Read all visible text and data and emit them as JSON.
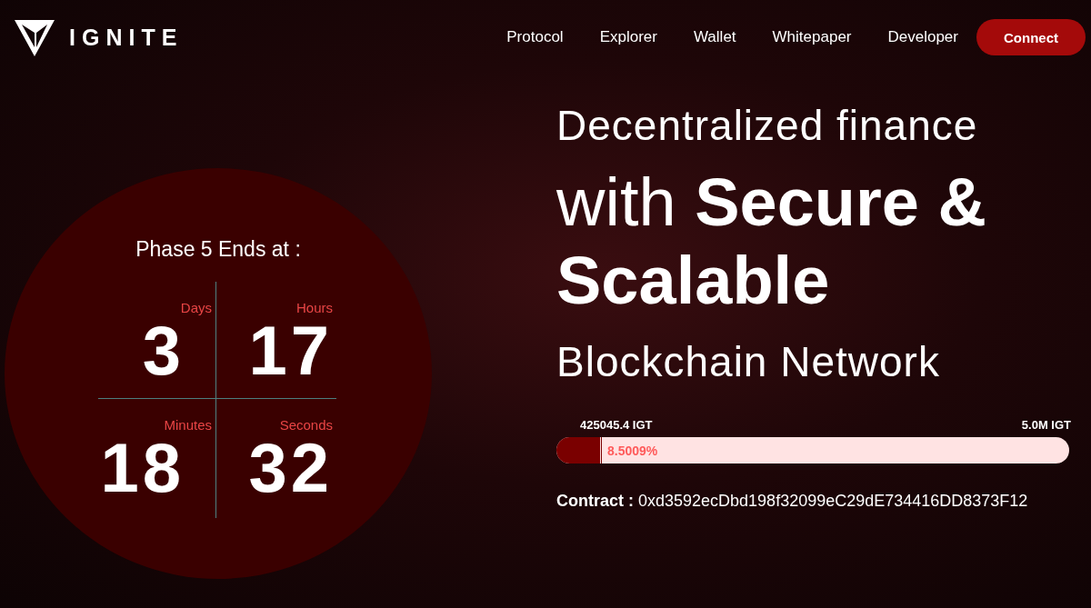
{
  "brand": {
    "name": "IGNITE"
  },
  "nav": {
    "items": [
      "Protocol",
      "Explorer",
      "Wallet",
      "Whitepaper",
      "Developer"
    ],
    "button": "Connect"
  },
  "countdown": {
    "title": "Phase 5 Ends at :",
    "units": [
      {
        "label": "Days",
        "value": "3"
      },
      {
        "label": "Hours",
        "value": "17"
      },
      {
        "label": "Minutes",
        "value": "18"
      },
      {
        "label": "Seconds",
        "value": "32"
      }
    ]
  },
  "hero": {
    "line_1": "Decentralized finance",
    "line_2": "with **Secure & Scalable**",
    "line_3": "Blockchain Network"
  },
  "progress": {
    "raised": "425045.4 IGT",
    "goal": "5.0M IGT",
    "level": 0.085,
    "percent": "8.5009%"
  },
  "contract": "**Contract :** 0xd3592ecDbd198f32099eC29dE734416DD8373F12"
}
